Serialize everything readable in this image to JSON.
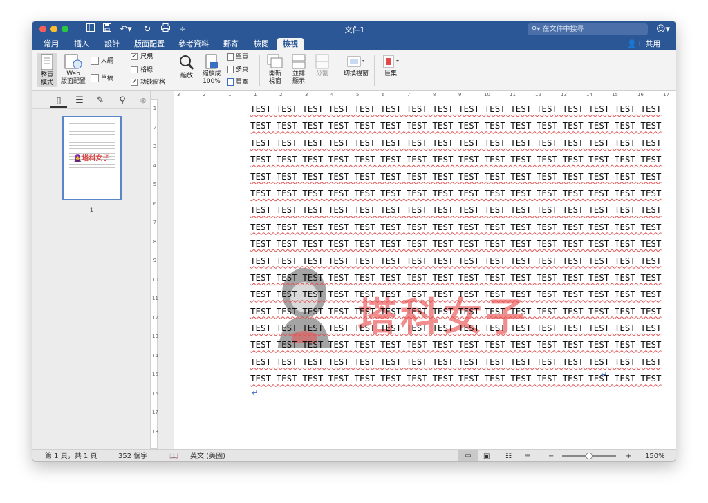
{
  "window": {
    "title": "文件1",
    "search_placeholder": "在文件中搜尋",
    "share_label": "共用"
  },
  "tabs": [
    {
      "label": "常用",
      "active": false
    },
    {
      "label": "插入",
      "active": false
    },
    {
      "label": "設計",
      "active": false
    },
    {
      "label": "版面配置",
      "active": false
    },
    {
      "label": "參考資料",
      "active": false
    },
    {
      "label": "郵寄",
      "active": false
    },
    {
      "label": "檢閱",
      "active": false
    },
    {
      "label": "檢視",
      "active": true
    }
  ],
  "ribbon": {
    "print_layout": [
      "整頁",
      "模式"
    ],
    "web_layout": [
      "Web",
      "版面配置"
    ],
    "outline": "大綱",
    "draft": "草稿",
    "ruler": "尺規",
    "gridlines": "格線",
    "nav_pane": "功能窗格",
    "zoom": "縮放",
    "zoom100": [
      "縮放成",
      "100%"
    ],
    "one_page": "單頁",
    "multi_page": "多頁",
    "page_width": "頁寬",
    "new_window": [
      "開新",
      "視窗"
    ],
    "arrange": [
      "並排",
      "顯示"
    ],
    "split": "分割",
    "switch_windows": "切換視窗",
    "macros": "巨集"
  },
  "checkboxes": {
    "ruler": true,
    "gridlines": false,
    "nav_pane": true
  },
  "sidebar": {
    "thumbnail_watermark": "塔科女子",
    "page_number": "1"
  },
  "ruler": {
    "h_marks": [
      "3",
      "2",
      "1",
      "1",
      "2",
      "3",
      "4",
      "5",
      "6",
      "7",
      "8",
      "9",
      "10",
      "11",
      "12",
      "13",
      "14",
      "15",
      "16",
      "17"
    ],
    "v_marks": [
      "1",
      "2",
      "3",
      "4",
      "5",
      "6",
      "7",
      "8",
      "9",
      "10",
      "11",
      "12",
      "13",
      "14",
      "15",
      "16",
      "17",
      "18"
    ]
  },
  "document": {
    "line_text": "TEST TEST TEST TEST TEST TEST TEST TEST TEST TEST TEST TEST TEST TEST TEST TEST",
    "line_count": 17,
    "watermark_text": "塔科女子"
  },
  "statusbar": {
    "page": "第 1 頁，共 1 頁",
    "words": "352 個字",
    "language": "英文 (美國)",
    "zoom": "150%",
    "zoom_level": 0.5
  },
  "colors": {
    "accent": "#2b5797",
    "watermark": "#eb5050"
  }
}
